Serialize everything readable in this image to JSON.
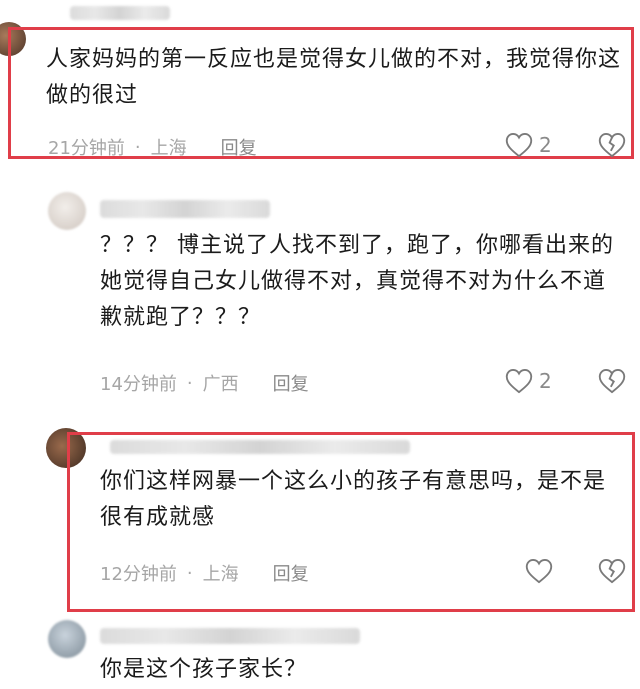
{
  "comments": [
    {
      "text": "人家妈妈的第一反应也是觉得女儿做的不对，我觉得你这做的很过",
      "time": "21分钟前",
      "location": "上海",
      "reply": "回复",
      "likes": "2"
    },
    {
      "text": "？？？ 博主说了人找不到了，跑了，你哪看出来的她觉得自己女儿做得不对，真觉得不对为什么不道歉就跑了？？？",
      "time": "14分钟前",
      "location": "广西",
      "reply": "回复",
      "likes": "2"
    },
    {
      "text": "你们这样网暴一个这么小的孩子有意思吗，是不是很有成就感",
      "time": "12分钟前",
      "location": "上海",
      "reply": "回复",
      "likes": ""
    },
    {
      "text": "你是这个孩子家长？"
    }
  ],
  "separator": "·",
  "colors": {
    "highlight_border": "#e03e49",
    "meta": "#a6a6a6"
  },
  "icons": {
    "like": "heart-outline-icon",
    "dislike": "broken-heart-icon"
  }
}
